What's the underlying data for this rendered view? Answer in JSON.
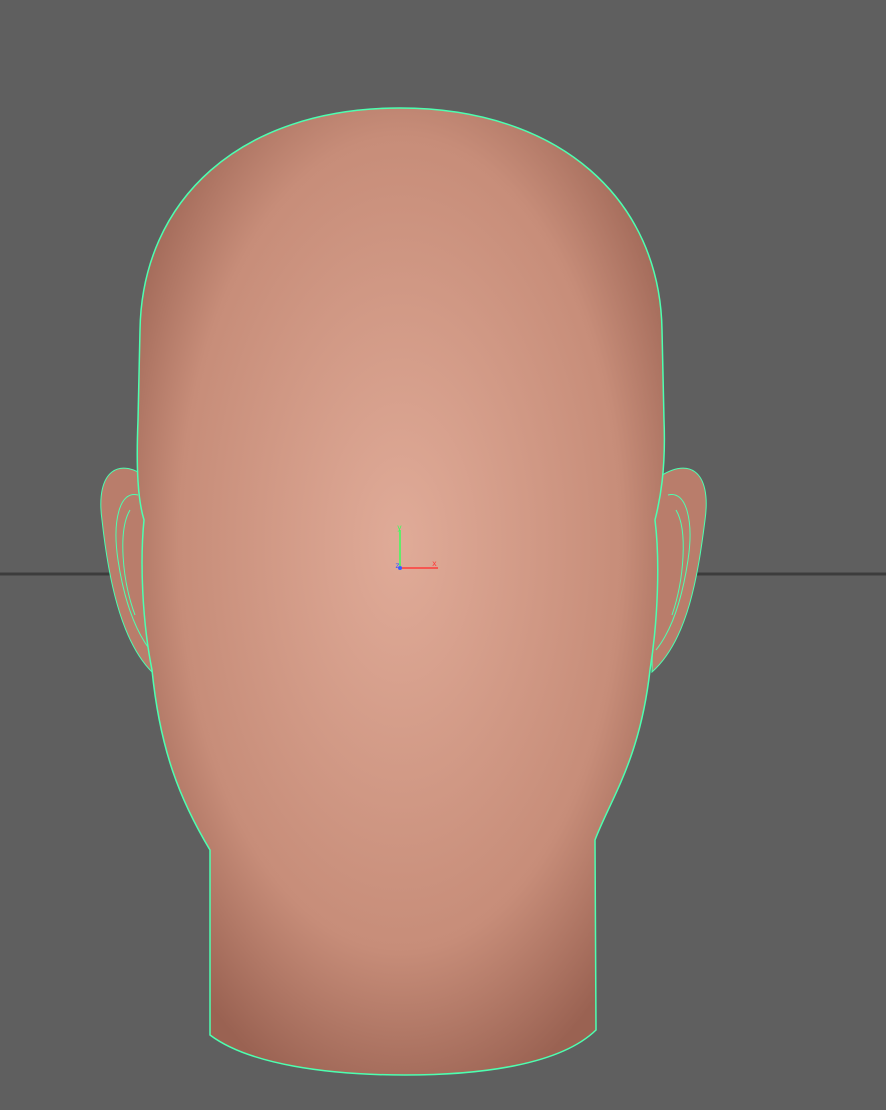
{
  "viewport": {
    "background_color": "#5f5f5f",
    "grid_line_color": "#3c3c3c"
  },
  "model": {
    "skin_color": "#d19a86",
    "skin_shadow_color": "#a86f5f",
    "wireframe_color": "#4dffb0",
    "eye_white_color": "#e6e6e6",
    "iris_color": "#8a9aa6",
    "selected": true
  },
  "axis_gizmo": {
    "x_label": "x",
    "y_label": "y",
    "z_label": "z",
    "x_color": "#ff3b3b",
    "y_color": "#3bff5a",
    "z_color": "#3b5bff"
  }
}
